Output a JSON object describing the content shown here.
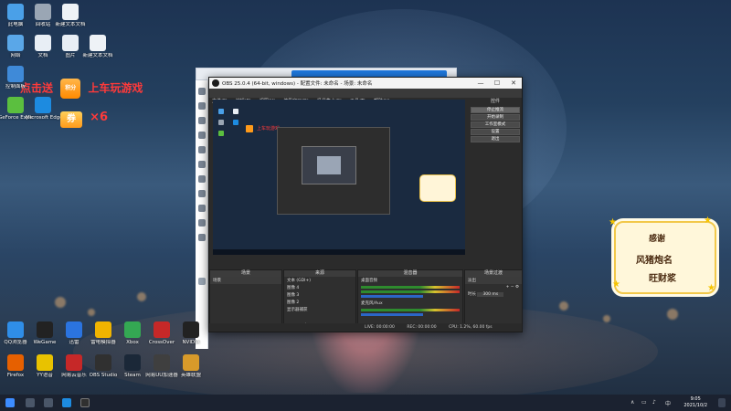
{
  "desktop": {
    "icons_top": [
      {
        "label": "此电脑",
        "color": "#4aa0e8"
      },
      {
        "label": "回收站",
        "color": "#9aa6b4"
      },
      {
        "label": "新建文本文档",
        "color": "#eef2f6"
      }
    ],
    "icons_right_col": [
      {
        "label": "文档",
        "color": "#e8eef5"
      },
      {
        "label": "图片",
        "color": "#e8eef5"
      },
      {
        "label": "新建文本文档",
        "color": "#eef2f6"
      }
    ],
    "icons_left_mid": [
      {
        "label": "网络",
        "color": "#5aa7e8"
      },
      {
        "label": "控制面板",
        "color": "#3f8ad8"
      },
      {
        "label": "GeForce Experience",
        "color": "#5bbf3f"
      },
      {
        "label": "Microsoft Edge",
        "color": "#1d8be0"
      }
    ],
    "icons_bottom_row1": [
      {
        "label": "QQ浏览器",
        "color": "#2f8ee8"
      },
      {
        "label": "WeGame",
        "color": "#222222"
      },
      {
        "label": "迅雷",
        "color": "#2b74e0"
      },
      {
        "label": "雷电模拟器",
        "color": "#f0b400"
      },
      {
        "label": "Xbox",
        "color": "#34a853"
      },
      {
        "label": "CrossOver",
        "color": "#c62828"
      },
      {
        "label": "NVIDIA",
        "color": "#222222"
      }
    ],
    "icons_bottom_row2": [
      {
        "label": "Firefox",
        "color": "#e66000"
      },
      {
        "label": "YY语音",
        "color": "#e8c200"
      },
      {
        "label": "网易云音乐",
        "color": "#c62828"
      },
      {
        "label": "OBS Studio",
        "color": "#303030"
      },
      {
        "label": "Steam",
        "color": "#1b2838"
      },
      {
        "label": "网易UU加速器",
        "color": "#3f3f3f"
      },
      {
        "label": "英雄联盟",
        "color": "#d89a2a"
      }
    ]
  },
  "promo": {
    "prefix": "点击",
    "mid": "送",
    "badge": "积分",
    "suffix": "上车玩游戏",
    "coupon": "券",
    "times": "×6"
  },
  "sticker": {
    "line1": "感谢",
    "line2": "风猪炮名",
    "line3": "旺财浆"
  },
  "obs": {
    "title": "OBS 25.0.4 (64-bit, windows) - 配置文件: 未命名 - 场景: 未命名",
    "menu": [
      "文件(F)",
      "编辑(E)",
      "视图(V)",
      "停靠窗口(D)",
      "场景集合(S)",
      "工具(T)",
      "帮助(H)"
    ],
    "controls_header": "控件",
    "controls": [
      "停止推流",
      "开始录制",
      "工作室模式",
      "设置",
      "退出"
    ],
    "docks": {
      "scenes": {
        "title": "场景",
        "items": [
          "场景"
        ]
      },
      "sources": {
        "title": "来源",
        "items": [
          "文本 (GDI+)",
          "图像 4",
          "图像 3",
          "图像 2",
          "显示器捕获"
        ]
      },
      "mixer": {
        "title": "混音器",
        "items": [
          "桌面音频",
          "麦克风/Aux"
        ]
      },
      "transitions": {
        "title": "场景过渡",
        "type": "淡出",
        "duration_label": "时长",
        "duration": "300 ms"
      }
    },
    "status": {
      "live": "LIVE: 00:00:00",
      "rec": "REC: 00:00:00",
      "cpu": "CPU: 1.2%, 60.00 fps"
    }
  },
  "taskbar": {
    "time": "9:05",
    "date": "2021/10/2"
  }
}
